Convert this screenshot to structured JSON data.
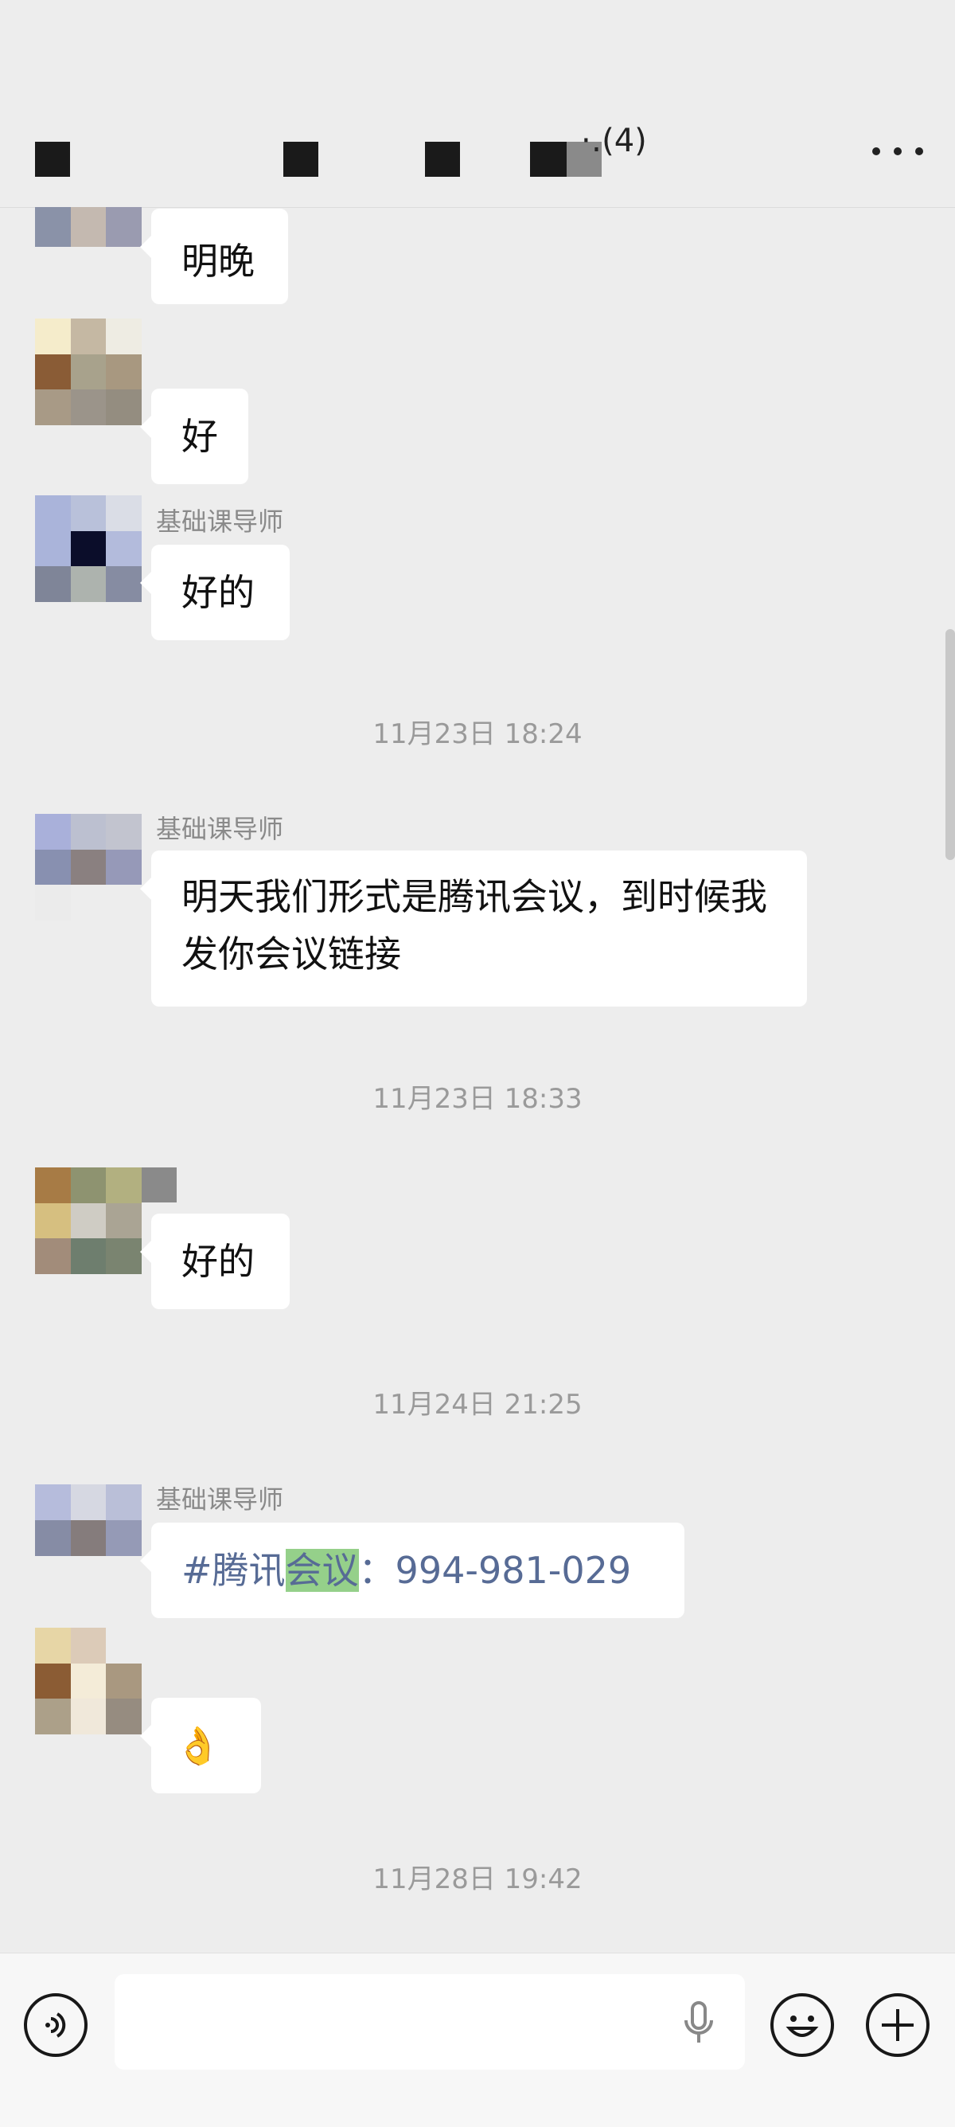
{
  "header": {
    "title_visible": "·․(4)",
    "more_icon": "more-icon"
  },
  "messages": [
    {
      "type": "bubble",
      "sender": "",
      "text": "明晚"
    },
    {
      "type": "bubble",
      "sender": "",
      "text": "好"
    },
    {
      "type": "bubble",
      "sender": "基础课导师",
      "text": "好的"
    },
    {
      "type": "time",
      "text": "11月23日 18:24"
    },
    {
      "type": "bubble",
      "sender": "基础课导师",
      "text": "明天我们形式是腾讯会议，到时候我发你会议链接"
    },
    {
      "type": "time",
      "text": "11月23日 18:33"
    },
    {
      "type": "bubble",
      "sender": "",
      "text": "好的"
    },
    {
      "type": "time",
      "text": "11月24日 21:25"
    },
    {
      "type": "bubble",
      "sender": "基础课导师",
      "text_parts": [
        "#腾讯",
        "会议",
        "：994-981-029"
      ]
    },
    {
      "type": "bubble",
      "sender": "",
      "text": "👌"
    },
    {
      "type": "time",
      "text": "11月28日 19:42"
    }
  ],
  "bottom_bar": {
    "voice_icon": "voice-icon",
    "input_value": "",
    "mic_icon": "microphone-icon",
    "emoji_icon": "emoji-icon",
    "plus_icon": "plus-icon"
  },
  "colors": {
    "background": "#ededed",
    "bubble": "#ffffff",
    "link": "#576b95",
    "highlight": "#95d08a"
  }
}
